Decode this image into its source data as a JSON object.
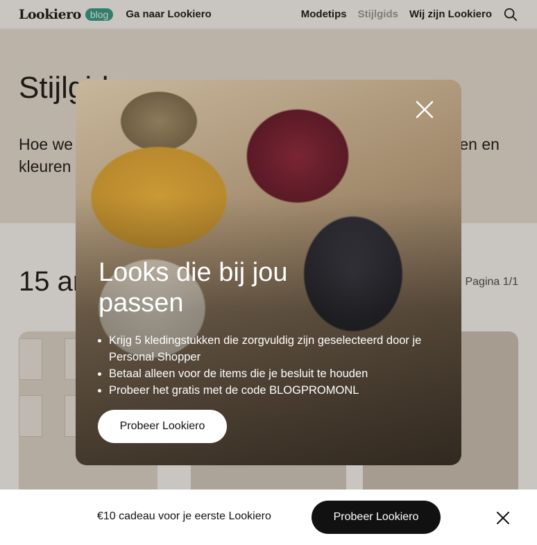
{
  "header": {
    "logo": "Lookiero",
    "badge": "blog",
    "goto": "Ga naar Lookiero",
    "nav": [
      "Modetips",
      "Stijlgids",
      "Wij zijn Lookiero"
    ],
    "search_icon": "search-icon"
  },
  "hero": {
    "title": "Stijlgids",
    "description": "Hoe we stijlen en kleuren combineren, de nieuwste trends, stijlen en kleuren ... hier."
  },
  "content": {
    "count_title": "15 artikelen",
    "pagination": "Pagina 1/1"
  },
  "modal": {
    "title": "Looks die bij jou passen",
    "bullets": [
      "Krijg 5 kledingstukken die zorgvuldig zijn geselecteerd door je Personal Shopper",
      "Betaal alleen voor de items die je besluit te houden",
      "Probeer het gratis met de code BLOGPROMONL"
    ],
    "button": "Probeer Lookiero",
    "close_icon": "close-icon"
  },
  "banner": {
    "text": "€10 cadeau voor je eerste Lookiero",
    "button": "Probeer Lookiero",
    "close_icon": "close-icon"
  }
}
